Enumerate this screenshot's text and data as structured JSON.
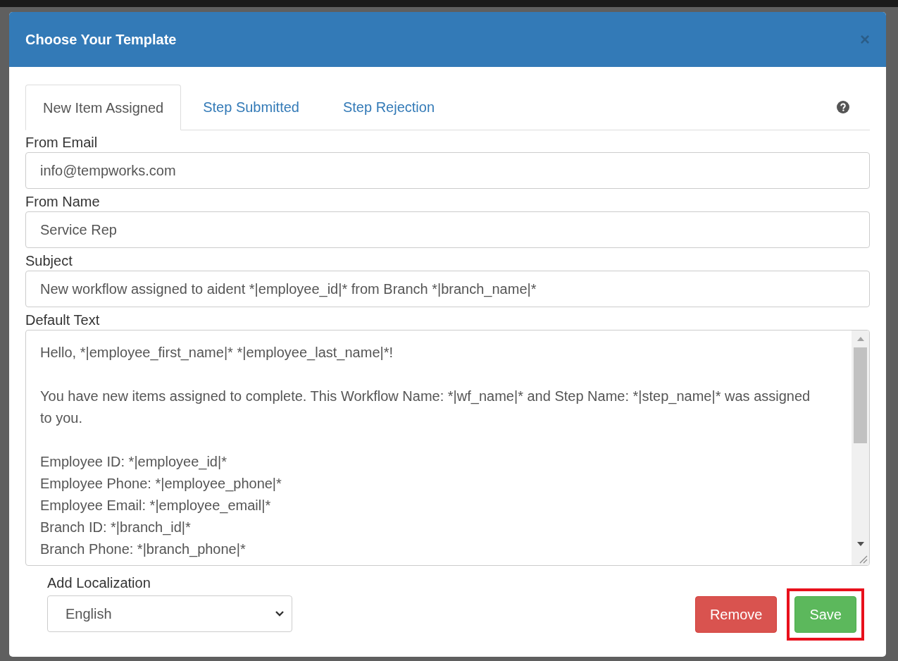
{
  "dialog": {
    "title": "Choose Your Template",
    "close": "×"
  },
  "tabs": [
    {
      "label": "New Item Assigned",
      "selected": true
    },
    {
      "label": "Step Submitted",
      "selected": false
    },
    {
      "label": "Step Rejection",
      "selected": false
    }
  ],
  "fields": [
    {
      "label": "From Email",
      "value": "info@tempworks.com"
    },
    {
      "label": "From Name",
      "value": "Service Rep"
    },
    {
      "label": "Subject",
      "value": "New workflow assigned to aident *|employee_id|* from Branch *|branch_name|*"
    }
  ],
  "default_text": {
    "label": "Default Text",
    "paragraphs": [
      [
        "Hello, *|employee_first_name|* *|employee_last_name|*!"
      ],
      [
        "You have new items assigned to complete. This Workflow Name: *|wf_name|* and Step Name: *|step_name|* was assigned to you."
      ],
      [
        "Employee ID: *|employee_id|*",
        "Employee Phone: *|employee_phone|*",
        "Employee Email: *|employee_email|*",
        "Branch ID: *|branch_id|*",
        "Branch Phone: *|branch_phone|*"
      ]
    ]
  },
  "localization": {
    "label": "Add Localization",
    "value": "English"
  },
  "buttons": [
    {
      "label": "Remove",
      "kind": "danger",
      "highlighted": false
    },
    {
      "label": "Save",
      "kind": "success",
      "highlighted": true
    }
  ]
}
